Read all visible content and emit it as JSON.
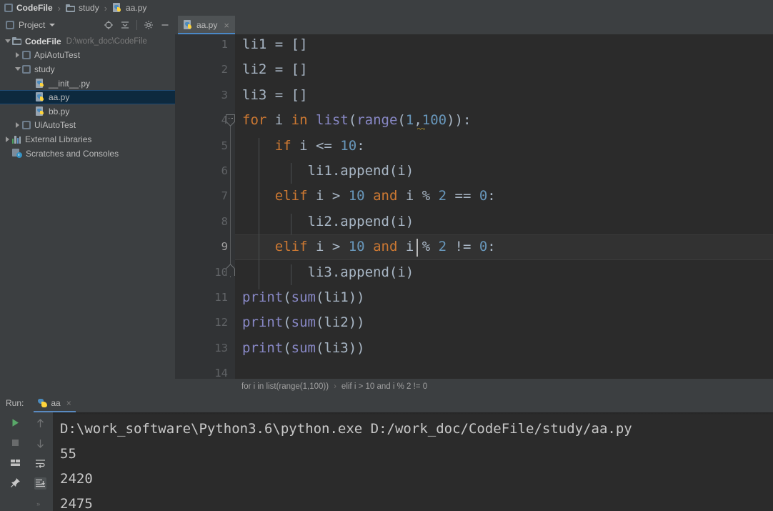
{
  "breadcrumb": {
    "items": [
      {
        "label": "CodeFile",
        "icon": "module-icon",
        "bold": true
      },
      {
        "label": "study",
        "icon": "folder-icon",
        "bold": false
      },
      {
        "label": "aa.py",
        "icon": "python-file-icon",
        "bold": false
      }
    ],
    "separator": "›"
  },
  "project_panel": {
    "title": "Project",
    "caret": "chevron-down-icon",
    "tools": [
      {
        "name": "locate-icon",
        "label": "Select Opened File"
      },
      {
        "name": "collapse-all-icon",
        "label": "Collapse All"
      },
      {
        "name": "gear-icon",
        "label": "Settings"
      },
      {
        "name": "minimize-icon",
        "label": "Hide"
      }
    ],
    "tree": [
      {
        "label": "CodeFile",
        "path": "D:\\work_doc\\CodeFile",
        "icon": "folder-icon",
        "indent": 0,
        "twisty": "expanded",
        "bold": true,
        "selected": false
      },
      {
        "label": "ApiAotuTest",
        "path": "",
        "icon": "module-icon",
        "indent": 1,
        "twisty": "collapsed",
        "bold": false,
        "selected": false
      },
      {
        "label": "study",
        "path": "",
        "icon": "module-icon",
        "indent": 1,
        "twisty": "expanded",
        "bold": false,
        "selected": false
      },
      {
        "label": "__init__.py",
        "path": "",
        "icon": "python-file-icon",
        "indent": 2,
        "twisty": "none",
        "bold": false,
        "selected": false
      },
      {
        "label": "aa.py",
        "path": "",
        "icon": "python-file-icon",
        "indent": 2,
        "twisty": "none",
        "bold": false,
        "selected": true
      },
      {
        "label": "bb.py",
        "path": "",
        "icon": "python-file-icon",
        "indent": 2,
        "twisty": "none",
        "bold": false,
        "selected": false
      },
      {
        "label": "UiAutoTest",
        "path": "",
        "icon": "module-icon",
        "indent": 1,
        "twisty": "collapsed",
        "bold": false,
        "selected": false
      },
      {
        "label": "External Libraries",
        "path": "",
        "icon": "library-icon",
        "indent": 0,
        "twisty": "collapsed",
        "bold": false,
        "selected": false
      },
      {
        "label": "Scratches and Consoles",
        "path": "",
        "icon": "scratches-icon",
        "indent": 0,
        "twisty": "none",
        "bold": false,
        "selected": false
      }
    ]
  },
  "editor": {
    "tab": {
      "label": "aa.py",
      "icon": "python-file-icon",
      "close": "×",
      "active": true
    },
    "lines": [
      {
        "n": "1",
        "tokens": [
          {
            "t": "li1 ",
            "c": "pl"
          },
          {
            "t": "= ",
            "c": "pl"
          },
          {
            "t": "[]",
            "c": "pl"
          }
        ]
      },
      {
        "n": "2",
        "tokens": [
          {
            "t": "li2 ",
            "c": "pl"
          },
          {
            "t": "= ",
            "c": "pl"
          },
          {
            "t": "[]",
            "c": "pl"
          }
        ]
      },
      {
        "n": "3",
        "tokens": [
          {
            "t": "li3 ",
            "c": "pl"
          },
          {
            "t": "= ",
            "c": "pl"
          },
          {
            "t": "[]",
            "c": "pl"
          }
        ]
      },
      {
        "n": "4",
        "tokens": [
          {
            "t": "for",
            "c": "kw"
          },
          {
            "t": " i ",
            "c": "pl"
          },
          {
            "t": "in",
            "c": "kw"
          },
          {
            "t": " ",
            "c": "pl"
          },
          {
            "t": "list",
            "c": "bi"
          },
          {
            "t": "(",
            "c": "pl"
          },
          {
            "t": "range",
            "c": "bi"
          },
          {
            "t": "(",
            "c": "pl"
          },
          {
            "t": "1",
            "c": "num"
          },
          {
            "t": ",",
            "c": "pl"
          },
          {
            "t": "100",
            "c": "num"
          },
          {
            "t": ")):",
            "c": "pl"
          }
        ]
      },
      {
        "n": "5",
        "tokens": [
          {
            "t": "    ",
            "c": "pl"
          },
          {
            "t": "if",
            "c": "kw"
          },
          {
            "t": " i <= ",
            "c": "pl"
          },
          {
            "t": "10",
            "c": "num"
          },
          {
            "t": ":",
            "c": "pl"
          }
        ]
      },
      {
        "n": "6",
        "tokens": [
          {
            "t": "        li1.append(i)",
            "c": "pl"
          }
        ]
      },
      {
        "n": "7",
        "tokens": [
          {
            "t": "    ",
            "c": "pl"
          },
          {
            "t": "elif",
            "c": "kw"
          },
          {
            "t": " i > ",
            "c": "pl"
          },
          {
            "t": "10",
            "c": "num"
          },
          {
            "t": " ",
            "c": "pl"
          },
          {
            "t": "and",
            "c": "kw"
          },
          {
            "t": " i % ",
            "c": "pl"
          },
          {
            "t": "2",
            "c": "num"
          },
          {
            "t": " == ",
            "c": "pl"
          },
          {
            "t": "0",
            "c": "num"
          },
          {
            "t": ":",
            "c": "pl"
          }
        ]
      },
      {
        "n": "8",
        "tokens": [
          {
            "t": "        li2.append(i)",
            "c": "pl"
          }
        ]
      },
      {
        "n": "9",
        "tokens": [
          {
            "t": "    ",
            "c": "pl"
          },
          {
            "t": "elif",
            "c": "kw"
          },
          {
            "t": " i > ",
            "c": "pl"
          },
          {
            "t": "10",
            "c": "num"
          },
          {
            "t": " ",
            "c": "pl"
          },
          {
            "t": "and",
            "c": "kw"
          },
          {
            "t": " i % ",
            "c": "pl"
          },
          {
            "t": "2",
            "c": "num"
          },
          {
            "t": " != ",
            "c": "pl"
          },
          {
            "t": "0",
            "c": "num"
          },
          {
            "t": ":",
            "c": "pl"
          }
        ]
      },
      {
        "n": "10",
        "tokens": [
          {
            "t": "        li3.append(i)",
            "c": "pl"
          }
        ]
      },
      {
        "n": "11",
        "tokens": [
          {
            "t": "print",
            "c": "bi"
          },
          {
            "t": "(",
            "c": "pl"
          },
          {
            "t": "sum",
            "c": "bi"
          },
          {
            "t": "(li1))",
            "c": "pl"
          }
        ]
      },
      {
        "n": "12",
        "tokens": [
          {
            "t": "print",
            "c": "bi"
          },
          {
            "t": "(",
            "c": "pl"
          },
          {
            "t": "sum",
            "c": "bi"
          },
          {
            "t": "(li2))",
            "c": "pl"
          }
        ]
      },
      {
        "n": "13",
        "tokens": [
          {
            "t": "print",
            "c": "bi"
          },
          {
            "t": "(",
            "c": "pl"
          },
          {
            "t": "sum",
            "c": "bi"
          },
          {
            "t": "(li3))",
            "c": "pl"
          }
        ]
      },
      {
        "n": "14",
        "tokens": []
      }
    ],
    "current_line": 9,
    "breadcrumbs": {
      "first": "for i in list(range(1,100))",
      "separator": "›",
      "second": "elif i > 10 and i % 2 != 0"
    }
  },
  "run_panel": {
    "label": "Run:",
    "tab": {
      "label": "aa",
      "icon": "python-icon",
      "close": "×"
    },
    "tools_left": [
      {
        "name": "run-icon",
        "state": "enabled"
      },
      {
        "name": "stop-icon",
        "state": "disabled"
      },
      {
        "name": "layout-icon",
        "state": "enabled"
      },
      {
        "name": "pin-icon",
        "state": "enabled"
      }
    ],
    "tools_right": [
      {
        "name": "up-arrow-icon",
        "state": "disabled"
      },
      {
        "name": "down-arrow-icon",
        "state": "disabled"
      },
      {
        "name": "soft-wrap-icon",
        "state": "enabled"
      },
      {
        "name": "scroll-to-end-icon",
        "state": "active"
      },
      {
        "name": "more-icon",
        "state": "disabled"
      }
    ],
    "console_lines": [
      "D:\\work_software\\Python3.6\\python.exe D:/work_doc/CodeFile/study/aa.py",
      "55",
      "2420",
      "2475"
    ]
  },
  "colors": {
    "panel_bg": "#3C3F41",
    "editor_bg": "#2B2B2B",
    "gutter_bg": "#313335",
    "keyword": "#CC7832",
    "number": "#6897BB",
    "builtin": "#8888C6",
    "plain": "#A9B7C6",
    "selection": "#0D293E",
    "tab_accent": "#4A88C7",
    "run_green": "#59A869"
  }
}
